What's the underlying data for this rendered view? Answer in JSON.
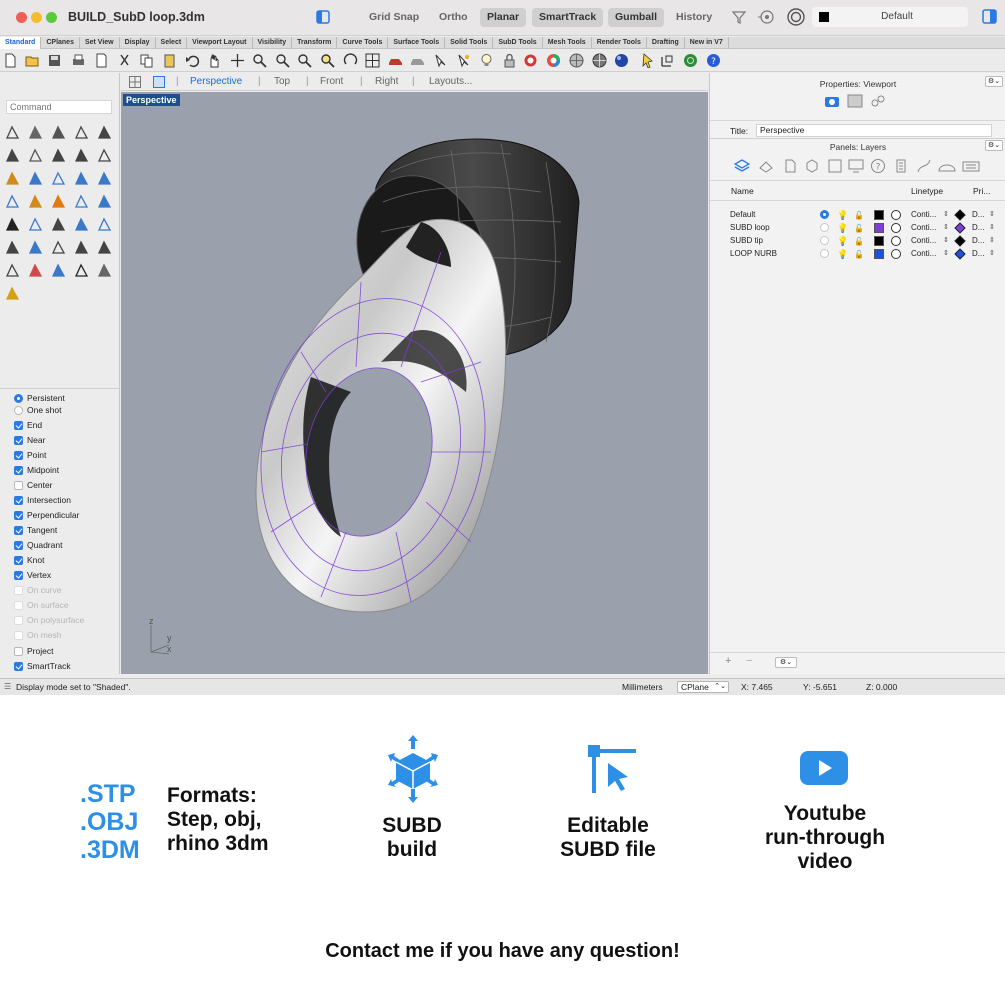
{
  "window": {
    "title": "BUILD_SubD loop.3dm",
    "buttons": [
      "Grid Snap",
      "Ortho",
      "Planar",
      "SmartTrack",
      "Gumball",
      "History"
    ],
    "active_buttons": [
      "Planar",
      "SmartTrack",
      "Gumball"
    ],
    "current_layer": "Default"
  },
  "tool_tabs": [
    "Standard",
    "CPlanes",
    "Set View",
    "Display",
    "Select",
    "Viewport Layout",
    "Visibility",
    "Transform",
    "Curve Tools",
    "Surface Tools",
    "Solid Tools",
    "SubD Tools",
    "Mesh Tools",
    "Render Tools",
    "Drafting",
    "New in V7"
  ],
  "command": {
    "placeholder": "Command"
  },
  "osnaps": {
    "modes": [
      {
        "label": "Persistent",
        "selected": true
      },
      {
        "label": "One shot",
        "selected": false
      }
    ],
    "items": [
      {
        "label": "End",
        "checked": true,
        "enabled": true
      },
      {
        "label": "Near",
        "checked": true,
        "enabled": true
      },
      {
        "label": "Point",
        "checked": true,
        "enabled": true
      },
      {
        "label": "Midpoint",
        "checked": true,
        "enabled": true
      },
      {
        "label": "Center",
        "checked": false,
        "enabled": true
      },
      {
        "label": "Intersection",
        "checked": true,
        "enabled": true
      },
      {
        "label": "Perpendicular",
        "checked": true,
        "enabled": true
      },
      {
        "label": "Tangent",
        "checked": true,
        "enabled": true
      },
      {
        "label": "Quadrant",
        "checked": true,
        "enabled": true
      },
      {
        "label": "Knot",
        "checked": true,
        "enabled": true
      },
      {
        "label": "Vertex",
        "checked": true,
        "enabled": true
      },
      {
        "label": "On curve",
        "checked": false,
        "enabled": false
      },
      {
        "label": "On surface",
        "checked": false,
        "enabled": false
      },
      {
        "label": "On polysurface",
        "checked": false,
        "enabled": false
      },
      {
        "label": "On mesh",
        "checked": false,
        "enabled": false
      },
      {
        "label": "Project",
        "checked": false,
        "enabled": true
      },
      {
        "label": "SmartTrack",
        "checked": true,
        "enabled": true
      }
    ]
  },
  "viewport_tabs": [
    "Perspective",
    "Top",
    "Front",
    "Right",
    "Layouts..."
  ],
  "viewport": {
    "label": "Perspective",
    "axis_labels": {
      "x": "x",
      "y": "y",
      "z": "z"
    }
  },
  "properties": {
    "header": "Properties: Viewport",
    "title_label": "Title:",
    "title_value": "Perspective"
  },
  "layers": {
    "header": "Panels: Layers",
    "columns": {
      "name": "Name",
      "linetype": "Linetype",
      "print": "Pri..."
    },
    "rows": [
      {
        "name": "Default",
        "current": true,
        "color": "#000000",
        "linetype": "Conti...",
        "print": "D...",
        "print_color": "#000000"
      },
      {
        "name": "SUBD loop",
        "current": false,
        "color": "#7b3fd6",
        "linetype": "Conti...",
        "print": "D...",
        "print_color": "#7b3fd6"
      },
      {
        "name": "SUBD tip",
        "current": false,
        "color": "#000000",
        "linetype": "Conti...",
        "print": "D...",
        "print_color": "#000000"
      },
      {
        "name": "LOOP NURB",
        "current": false,
        "color": "#1e4fe0",
        "linetype": "Conti...",
        "print": "D...",
        "print_color": "#1e4fe0"
      }
    ],
    "footer": {
      "add": "+",
      "remove": "−"
    }
  },
  "status": {
    "message": "Display mode set to \"Shaded\".",
    "units": "Millimeters",
    "cplane": "CPlane",
    "x": "X: 7.465",
    "y": "Y: -5.651",
    "z": "Z: 0.000"
  },
  "promo": {
    "format_codes": [
      ".STP",
      ".OBJ",
      ".3DM"
    ],
    "formats_heading": "Formats:",
    "formats_lines": [
      "Step, obj,",
      "rhino 3dm"
    ],
    "features": [
      {
        "icon": "subd-cube-icon",
        "lines": [
          "SUBD",
          "build"
        ]
      },
      {
        "icon": "edit-cursor-icon",
        "lines": [
          "Editable",
          "SUBD file"
        ]
      },
      {
        "icon": "youtube-play-icon",
        "lines": [
          "Youtube",
          "run-through",
          "video"
        ]
      }
    ],
    "contact": "Contact me if you have any question!",
    "accent_color": "#2e8fe6"
  }
}
